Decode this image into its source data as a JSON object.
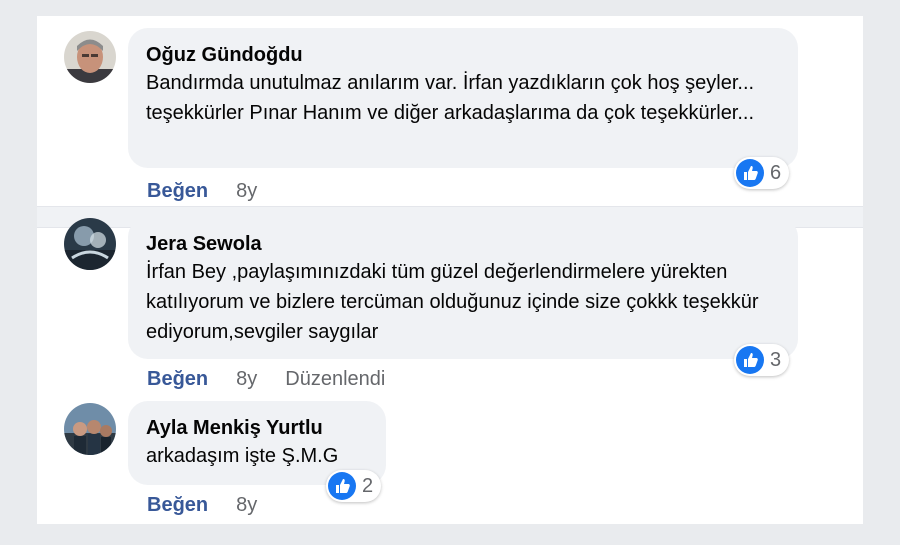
{
  "comments": [
    {
      "author": "Oğuz Gündoğdu",
      "text": "Bandırmda unutulmaz anılarım var. İrfan yazdıkların çok hoş şeyler... teşekkürler Pınar Hanım ve diğer arkadaşlarıma da çok teşekkürler...",
      "like_label": "Beğen",
      "time": "8y",
      "reaction_count": "6"
    },
    {
      "author": "Jera Sewola",
      "text": "İrfan Bey ,paylaşımınızdaki tüm güzel değerlendirmelere yürekten katılıyorum ve bizlere tercüman olduğunuz içinde size çokkk teşekkür ediyorum,sevgiler saygılar",
      "like_label": "Beğen",
      "time": "8y",
      "edited_label": "Düzenlendi",
      "reaction_count": "3"
    },
    {
      "author": "Ayla Menkiş Yurtlu",
      "text": "arkadaşım işte Ş.M.G",
      "like_label": "Beğen",
      "time": "8y",
      "reaction_count": "2"
    }
  ],
  "colors": {
    "like_blue": "#1877f2",
    "link_blue": "#385898",
    "bubble_gray": "#f0f2f5"
  },
  "icons": {
    "reaction": "thumbs-up-icon"
  }
}
